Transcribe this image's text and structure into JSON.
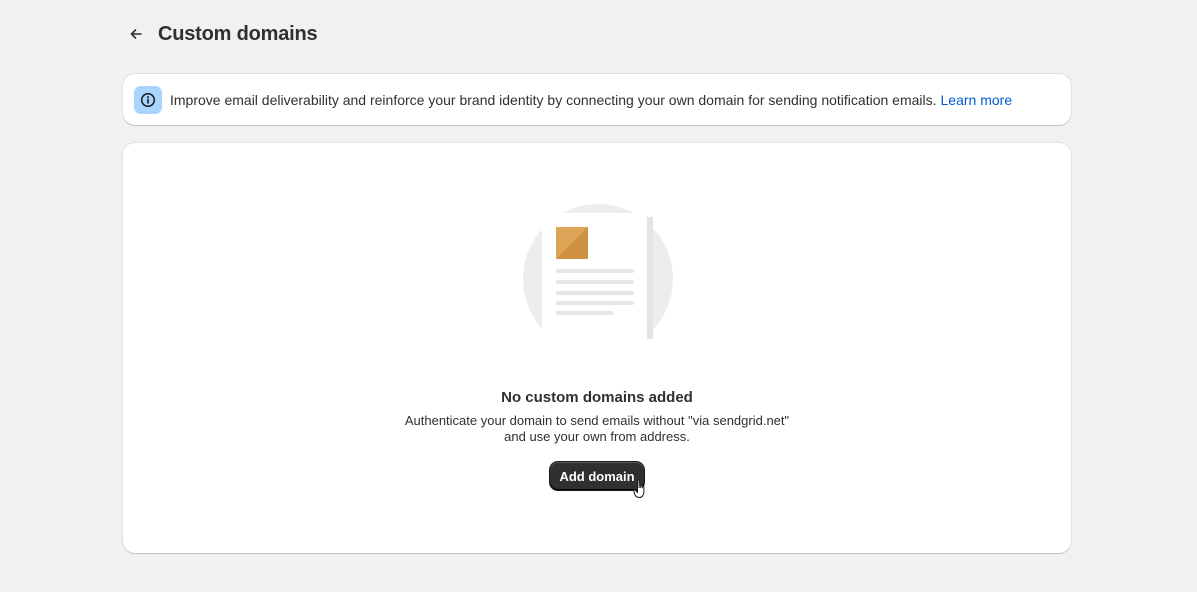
{
  "header": {
    "title": "Custom domains",
    "back_icon": "arrow-left-icon"
  },
  "banner": {
    "icon": "info-icon",
    "icon_bg": "#a8d4ff",
    "text": "Improve email deliverability and reinforce your brand identity by connecting your own domain for sending notification emails.",
    "link": "Learn more",
    "link_color": "#005bd3"
  },
  "empty_state": {
    "illustration": "document-illustration",
    "heading": "No custom domains added",
    "description_line1": "Authenticate your domain to send emails without \"via sendgrid.net\"",
    "description_line2": "and use your own from address.",
    "button_label": "Add domain",
    "button_color": "#303030"
  },
  "cursor": "hand-pointer-icon"
}
